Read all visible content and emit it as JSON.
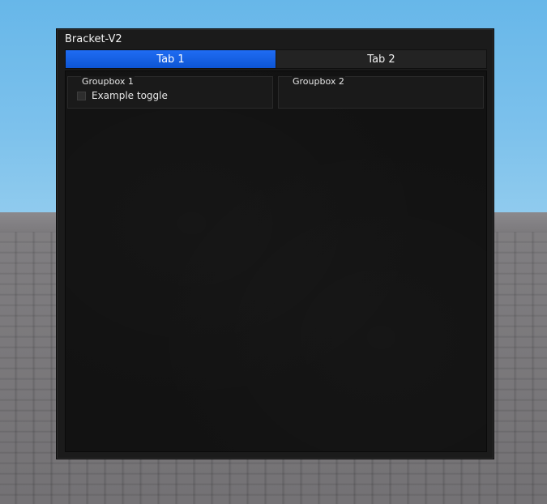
{
  "window": {
    "title": "Bracket-V2"
  },
  "tabs": [
    {
      "label": "Tab 1",
      "active": true
    },
    {
      "label": "Tab 2",
      "active": false
    }
  ],
  "groupboxes": [
    {
      "title": "Groupbox 1",
      "toggles": [
        {
          "label": "Example toggle",
          "checked": false
        }
      ]
    },
    {
      "title": "Groupbox 2",
      "toggles": []
    }
  ],
  "colors": {
    "accent": "#1463e8",
    "window_bg": "#1b1b1b",
    "content_bg": "#121212",
    "groupbox_bg": "#1a1a1a",
    "text": "#f0f0f0"
  }
}
